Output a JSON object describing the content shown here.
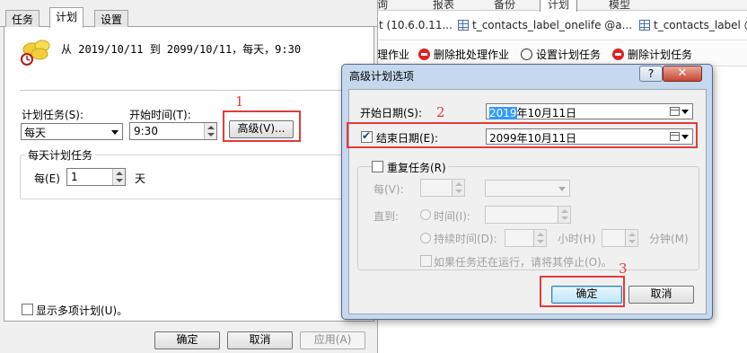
{
  "background": {
    "top_tabs": [
      "询",
      "报表",
      "备份",
      "计划",
      "模型"
    ],
    "active_top_tab": "计划",
    "editor_tabs": [
      "t (10.6.0.11...",
      "t_contacts_label_onelife @a...",
      "t_contacts_label @a"
    ],
    "toolbar": [
      "理作业",
      "删除批处理作业",
      "设置计划任务",
      "删除计划任务"
    ]
  },
  "left_dialog": {
    "tabs": [
      "任务",
      "计划",
      "设置"
    ],
    "active_tab": "计划",
    "summary": "从 2019/10/11 到 2099/10/11，每天，9:30",
    "schedule_task_label": "计划任务(S):",
    "schedule_task_value": "每天",
    "start_time_label": "开始时间(T):",
    "start_time_value": "9:30",
    "advanced_button": "高级(V)...",
    "daily_group_title": "每天计划任务",
    "every_label": "每(E)",
    "every_value": "1",
    "every_unit": "天",
    "show_multiple_label": "显示多项计划(U)。",
    "ok_button": "确定",
    "cancel_button": "取消",
    "apply_button": "应用(A)"
  },
  "advanced_dialog": {
    "title": "高级计划选项",
    "help_button": "?",
    "close_button": "✕",
    "start_date_label": "开始日期(S):",
    "start_date_year": "2019",
    "start_date_rest": "年10月11日",
    "end_date_label": "结束日期(E):",
    "end_date_value": "2099年10月11日",
    "end_date_checked": true,
    "repeat_label": "重复任务(R)",
    "repeat_checked": false,
    "every_label": "每(V):",
    "until_label": "直到:",
    "time_label": "时间(I):",
    "duration_label": "持续时间(D):",
    "hours_label": "小时(H)",
    "minutes_label": "分钟(M)",
    "stop_if_running_label": "如果任务还在运行，请将其停止(O)。",
    "ok_button": "确定",
    "cancel_button": "取消"
  },
  "annotations": {
    "step1": "1",
    "step2": "2",
    "step3": "3",
    "color": "#e23b3b"
  }
}
